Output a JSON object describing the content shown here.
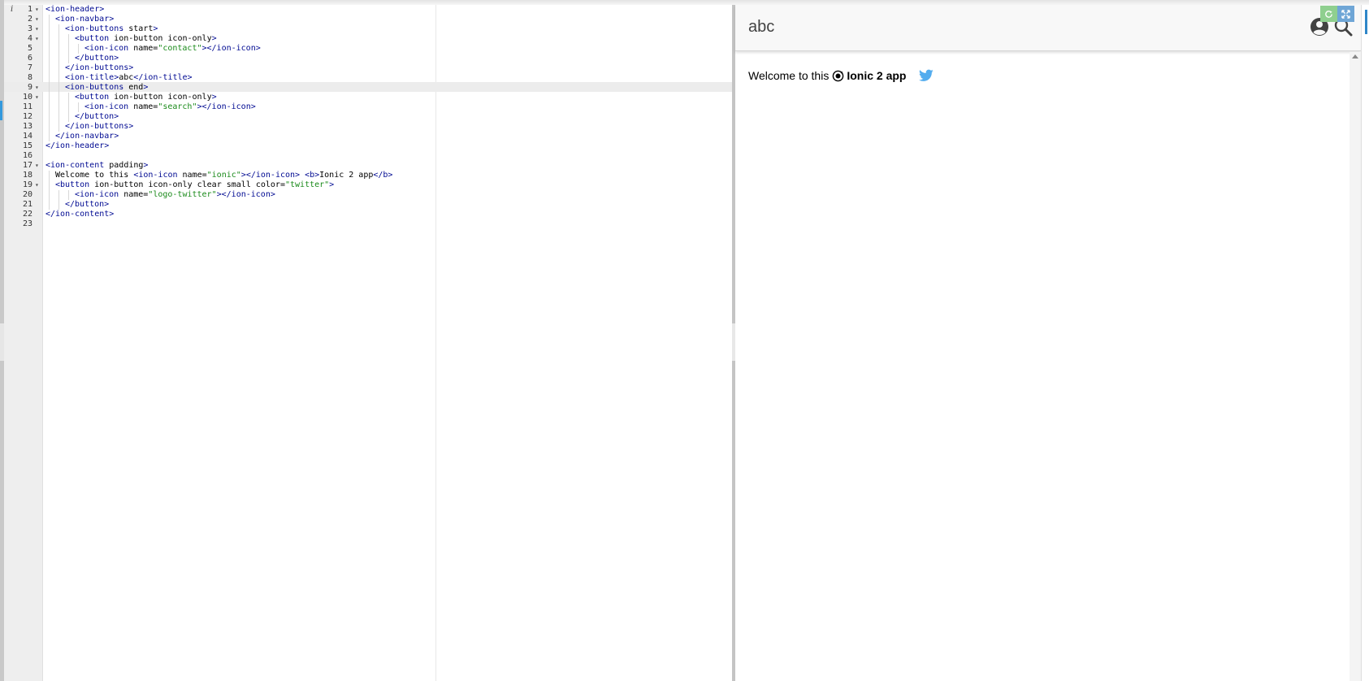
{
  "editor": {
    "lines": [
      {
        "n": "1",
        "fold": true,
        "indent": 0,
        "parts": [
          {
            "c": "tag",
            "t": "<ion-header>"
          }
        ]
      },
      {
        "n": "2",
        "fold": true,
        "indent": 1,
        "parts": [
          {
            "c": "tag",
            "t": "<ion-navbar>"
          }
        ]
      },
      {
        "n": "3",
        "fold": true,
        "indent": 2,
        "parts": [
          {
            "c": "tag",
            "t": "<ion-buttons"
          },
          {
            "c": "txt",
            "t": " start"
          },
          {
            "c": "tag",
            "t": ">"
          }
        ]
      },
      {
        "n": "4",
        "fold": true,
        "indent": 3,
        "parts": [
          {
            "c": "tag",
            "t": "<button"
          },
          {
            "c": "txt",
            "t": " ion-button icon-only"
          },
          {
            "c": "tag",
            "t": ">"
          }
        ]
      },
      {
        "n": "5",
        "fold": false,
        "indent": 4,
        "parts": [
          {
            "c": "tag",
            "t": "<ion-icon"
          },
          {
            "c": "txt",
            "t": " name="
          },
          {
            "c": "str",
            "t": "\"contact\""
          },
          {
            "c": "tag",
            "t": "></ion-icon>"
          }
        ]
      },
      {
        "n": "6",
        "fold": false,
        "indent": 3,
        "parts": [
          {
            "c": "tag",
            "t": "</button>"
          }
        ]
      },
      {
        "n": "7",
        "fold": false,
        "indent": 2,
        "parts": [
          {
            "c": "tag",
            "t": "</ion-buttons>"
          }
        ]
      },
      {
        "n": "8",
        "fold": false,
        "indent": 2,
        "parts": [
          {
            "c": "tag",
            "t": "<ion-title>"
          },
          {
            "c": "txt",
            "t": "abc"
          },
          {
            "c": "tag",
            "t": "</ion-title>"
          }
        ]
      },
      {
        "n": "9",
        "fold": true,
        "indent": 2,
        "parts": [
          {
            "c": "tag",
            "t": "<ion-buttons"
          },
          {
            "c": "txt",
            "t": " end"
          },
          {
            "c": "tag",
            "t": ">"
          }
        ]
      },
      {
        "n": "10",
        "fold": true,
        "indent": 3,
        "parts": [
          {
            "c": "tag",
            "t": "<button"
          },
          {
            "c": "txt",
            "t": " ion-button icon-only"
          },
          {
            "c": "tag",
            "t": ">"
          }
        ]
      },
      {
        "n": "11",
        "fold": false,
        "indent": 4,
        "parts": [
          {
            "c": "tag",
            "t": "<ion-icon"
          },
          {
            "c": "txt",
            "t": " name="
          },
          {
            "c": "str",
            "t": "\"search\""
          },
          {
            "c": "tag",
            "t": "></ion-icon>"
          }
        ]
      },
      {
        "n": "12",
        "fold": false,
        "indent": 3,
        "parts": [
          {
            "c": "tag",
            "t": "</button>"
          }
        ]
      },
      {
        "n": "13",
        "fold": false,
        "indent": 2,
        "parts": [
          {
            "c": "tag",
            "t": "</ion-buttons>"
          }
        ]
      },
      {
        "n": "14",
        "fold": false,
        "indent": 1,
        "parts": [
          {
            "c": "tag",
            "t": "</ion-navbar>"
          }
        ]
      },
      {
        "n": "15",
        "fold": false,
        "indent": 0,
        "parts": [
          {
            "c": "tag",
            "t": "</ion-header>"
          }
        ]
      },
      {
        "n": "16",
        "fold": false,
        "indent": 0,
        "parts": []
      },
      {
        "n": "17",
        "fold": true,
        "indent": 0,
        "parts": [
          {
            "c": "tag",
            "t": "<ion-content"
          },
          {
            "c": "txt",
            "t": " padding"
          },
          {
            "c": "tag",
            "t": ">"
          }
        ]
      },
      {
        "n": "18",
        "fold": false,
        "indent": 1,
        "parts": [
          {
            "c": "txt",
            "t": "Welcome to this "
          },
          {
            "c": "tag",
            "t": "<ion-icon"
          },
          {
            "c": "txt",
            "t": " name="
          },
          {
            "c": "str",
            "t": "\"ionic\""
          },
          {
            "c": "tag",
            "t": "></ion-icon>"
          },
          {
            "c": "txt",
            "t": " "
          },
          {
            "c": "tag",
            "t": "<b>"
          },
          {
            "c": "txt",
            "t": "Ionic 2 app"
          },
          {
            "c": "tag",
            "t": "</b>"
          }
        ]
      },
      {
        "n": "19",
        "fold": true,
        "indent": 1,
        "parts": [
          {
            "c": "tag",
            "t": "<button"
          },
          {
            "c": "txt",
            "t": " ion-button icon-only clear small color="
          },
          {
            "c": "str",
            "t": "\"twitter\""
          },
          {
            "c": "tag",
            "t": ">"
          }
        ]
      },
      {
        "n": "20",
        "fold": false,
        "indent": 3,
        "parts": [
          {
            "c": "tag",
            "t": "<ion-icon"
          },
          {
            "c": "txt",
            "t": " name="
          },
          {
            "c": "str",
            "t": "\"logo-twitter\""
          },
          {
            "c": "tag",
            "t": "></ion-icon>"
          }
        ]
      },
      {
        "n": "21",
        "fold": false,
        "indent": 2,
        "parts": [
          {
            "c": "tag",
            "t": "</button>"
          }
        ]
      },
      {
        "n": "22",
        "fold": false,
        "indent": 0,
        "parts": [
          {
            "c": "tag",
            "t": "</ion-content>"
          }
        ]
      },
      {
        "n": "23",
        "fold": false,
        "indent": 0,
        "parts": []
      }
    ]
  },
  "preview": {
    "title": "abc",
    "welcome_text": "Welcome to this",
    "app_name": "Ionic 2 app",
    "icons": {
      "start_button": "contact-icon",
      "end_button": "search-icon",
      "inline": "ionic-icon",
      "twitter_button": "logo-twitter-icon"
    },
    "colors": {
      "twitter": "#53acee",
      "navbar_bg": "#f8f8f8",
      "title": "#424242"
    }
  },
  "controls": {
    "refresh_icon": "refresh-icon",
    "expand_icon": "expand-icon"
  }
}
